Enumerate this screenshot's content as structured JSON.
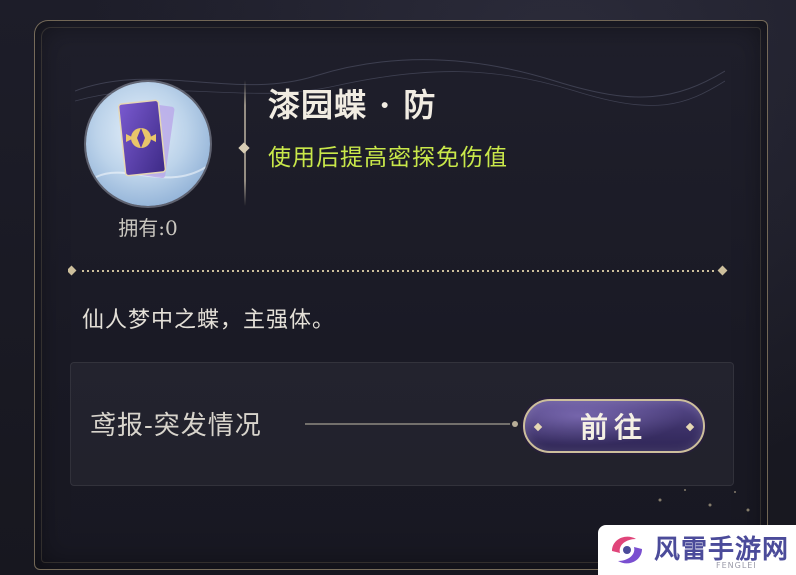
{
  "item": {
    "name": "漆园蝶 · 防",
    "effect": "使用后提高密探免伤值",
    "owned_label": "拥有:0",
    "flavor_text": "仙人梦中之蝶，主强体。",
    "icon": "butterfly-card-icon"
  },
  "source": {
    "label": "鸢报-突发情况",
    "goto_label": "前往"
  },
  "watermark": {
    "text": "风雷手游网",
    "sub": "FENGLEI"
  },
  "colors": {
    "effect_text": "#c9e84a",
    "border_gold": "#cdbf9c",
    "button_purple": "#4a3d7a"
  }
}
